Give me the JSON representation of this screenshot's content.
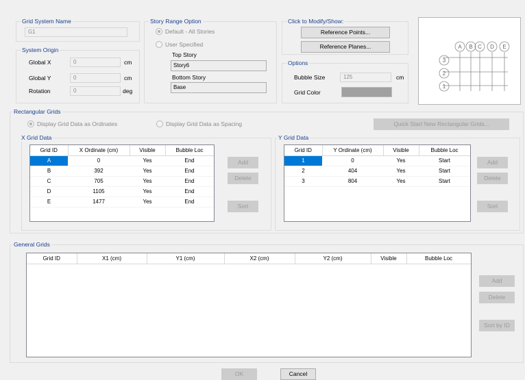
{
  "grid_system": {
    "group_title": "Grid System Name",
    "name": "G1"
  },
  "system_origin": {
    "group_title": "System Origin",
    "rows": [
      {
        "label": "Global X",
        "value": "0",
        "unit": "cm"
      },
      {
        "label": "Global Y",
        "value": "0",
        "unit": "cm"
      },
      {
        "label": "Rotation",
        "value": "0",
        "unit": "deg"
      }
    ]
  },
  "story_range": {
    "group_title": "Story Range Option",
    "option_default": "Default - All Stories",
    "option_user": "User Specified",
    "top_story_label": "Top Story",
    "top_story_value": "Story6",
    "bottom_story_label": "Bottom Story",
    "bottom_story_value": "Base"
  },
  "modify_show": {
    "group_title": "Click to Modify/Show:",
    "reference_points": "Reference Points...",
    "reference_planes": "Reference Planes..."
  },
  "options": {
    "group_title": "Options",
    "bubble_size_label": "Bubble Size",
    "bubble_size_value": "125",
    "bubble_size_unit": "cm",
    "grid_color_label": "Grid Color",
    "grid_color": "#a0a0a0"
  },
  "preview": {
    "x_bubbles": [
      "A",
      "B",
      "C",
      "D",
      "E"
    ],
    "y_bubbles": [
      "3",
      "2",
      "1"
    ]
  },
  "rectangular": {
    "group_title": "Rectangular Grids",
    "display_ordinates": "Display Grid Data as Ordinates",
    "display_spacing": "Display Grid Data as Spacing",
    "quick_start": "Quick Start New Rectangular Grids..."
  },
  "x_grid": {
    "group_title": "X Grid Data",
    "headers": [
      "Grid ID",
      "X Ordinate (cm)",
      "Visible",
      "Bubble Loc"
    ],
    "rows": [
      [
        "A",
        "0",
        "Yes",
        "End"
      ],
      [
        "B",
        "392",
        "Yes",
        "End"
      ],
      [
        "C",
        "705",
        "Yes",
        "End"
      ],
      [
        "D",
        "1105",
        "Yes",
        "End"
      ],
      [
        "E",
        "1477",
        "Yes",
        "End"
      ]
    ],
    "add": "Add",
    "delete": "Delete",
    "sort": "Sort"
  },
  "y_grid": {
    "group_title": "Y Grid Data",
    "headers": [
      "Grid ID",
      "Y Ordinate (cm)",
      "Visible",
      "Bubble Loc"
    ],
    "rows": [
      [
        "1",
        "0",
        "Yes",
        "Start"
      ],
      [
        "2",
        "404",
        "Yes",
        "Start"
      ],
      [
        "3",
        "804",
        "Yes",
        "Start"
      ]
    ],
    "add": "Add",
    "delete": "Delete",
    "sort": "Sort"
  },
  "general": {
    "group_title": "General Grids",
    "headers": [
      "Grid ID",
      "X1 (cm)",
      "Y1 (cm)",
      "X2 (cm)",
      "Y2 (cm)",
      "Visible",
      "Bubble Loc"
    ],
    "add": "Add",
    "delete": "Delete",
    "sort_by_id": "Sort by ID"
  },
  "footer": {
    "ok": "OK",
    "cancel": "Cancel"
  }
}
